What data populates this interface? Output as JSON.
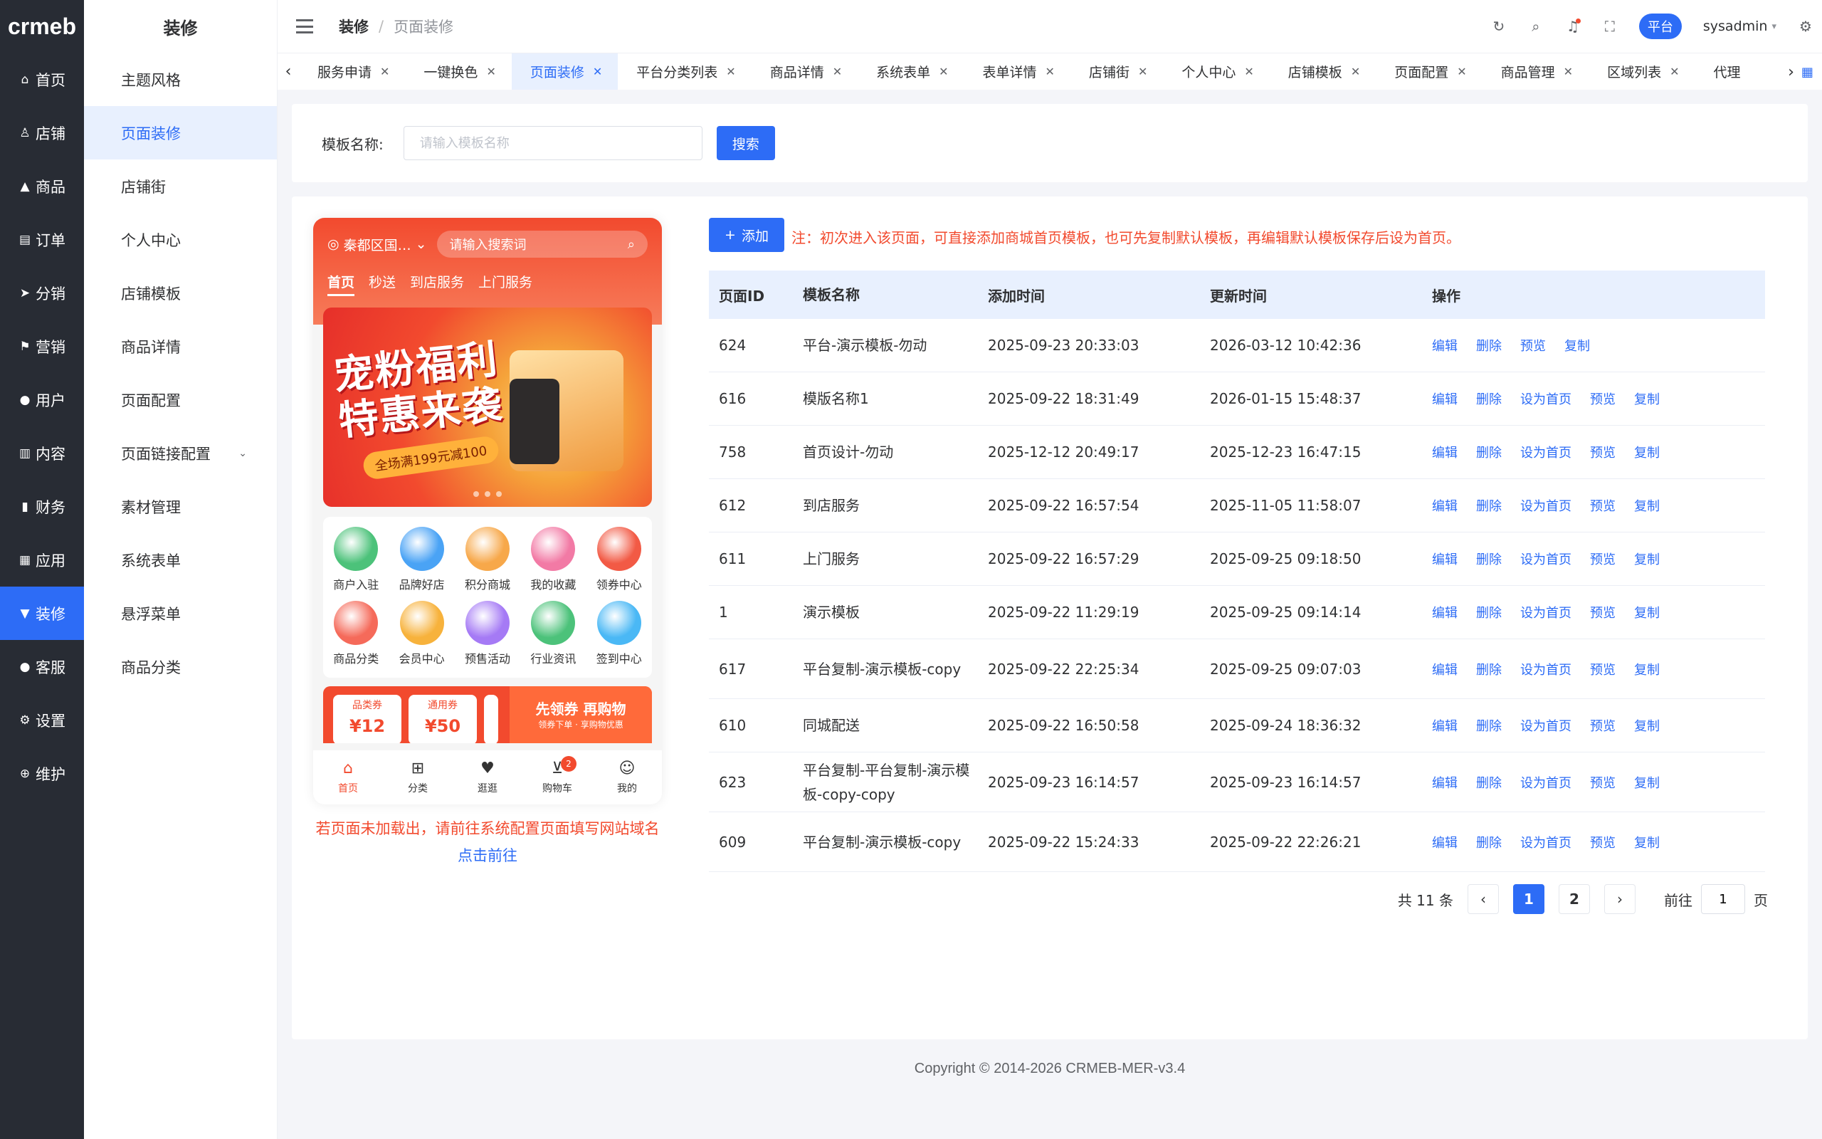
{
  "logo": "crmeb",
  "main_nav": [
    {
      "label": "首页",
      "icon": "home-icon",
      "glyph": "⌂",
      "active": false
    },
    {
      "label": "店铺",
      "icon": "store-icon",
      "glyph": "♙",
      "active": false
    },
    {
      "label": "商品",
      "icon": "bag-icon",
      "glyph": "▲",
      "active": false
    },
    {
      "label": "订单",
      "icon": "order-icon",
      "glyph": "▤",
      "active": false
    },
    {
      "label": "分销",
      "icon": "send-icon",
      "glyph": "➤",
      "active": false
    },
    {
      "label": "营销",
      "icon": "flag-icon",
      "glyph": "⚑",
      "active": false
    },
    {
      "label": "用户",
      "icon": "user-icon",
      "glyph": "●",
      "active": false
    },
    {
      "label": "内容",
      "icon": "content-icon",
      "glyph": "▥",
      "active": false
    },
    {
      "label": "财务",
      "icon": "finance-icon",
      "glyph": "▮",
      "active": false
    },
    {
      "label": "应用",
      "icon": "apps-icon",
      "glyph": "▦",
      "active": false
    },
    {
      "label": "装修",
      "icon": "brush-icon",
      "glyph": "▼",
      "active": true
    },
    {
      "label": "客服",
      "icon": "service-icon",
      "glyph": "●",
      "active": false
    },
    {
      "label": "设置",
      "icon": "gear-icon",
      "glyph": "⚙",
      "active": false
    },
    {
      "label": "维护",
      "icon": "maintain-icon",
      "glyph": "⊕",
      "active": false
    }
  ],
  "sub_nav": {
    "title": "装修",
    "items": [
      {
        "label": "主题风格",
        "active": false
      },
      {
        "label": "页面装修",
        "active": true
      },
      {
        "label": "店铺街",
        "active": false
      },
      {
        "label": "个人中心",
        "active": false
      },
      {
        "label": "店铺模板",
        "active": false
      },
      {
        "label": "商品详情",
        "active": false
      },
      {
        "label": "页面配置",
        "active": false
      },
      {
        "label": "页面链接配置",
        "active": false,
        "expandable": true
      },
      {
        "label": "素材管理",
        "active": false
      },
      {
        "label": "系统表单",
        "active": false
      },
      {
        "label": "悬浮菜单",
        "active": false
      },
      {
        "label": "商品分类",
        "active": false
      }
    ]
  },
  "header": {
    "breadcrumb_1": "装修",
    "breadcrumb_sep": "/",
    "breadcrumb_2": "页面装修",
    "platform_badge": "平台",
    "username": "sysadmin"
  },
  "tabs": [
    {
      "label": "服务申请",
      "active": false
    },
    {
      "label": "一键换色",
      "active": false
    },
    {
      "label": "页面装修",
      "active": true
    },
    {
      "label": "平台分类列表",
      "active": false
    },
    {
      "label": "商品详情",
      "active": false
    },
    {
      "label": "系统表单",
      "active": false
    },
    {
      "label": "表单详情",
      "active": false
    },
    {
      "label": "店铺街",
      "active": false
    },
    {
      "label": "个人中心",
      "active": false
    },
    {
      "label": "店铺模板",
      "active": false
    },
    {
      "label": "页面配置",
      "active": false
    },
    {
      "label": "商品管理",
      "active": false
    },
    {
      "label": "区域列表",
      "active": false
    },
    {
      "label": "代理",
      "active": false
    }
  ],
  "search": {
    "label": "模板名称:",
    "placeholder": "请输入模板名称",
    "button": "搜索"
  },
  "phone": {
    "location": "秦都区国…",
    "search_placeholder": "请输入搜索词",
    "nav": [
      "首页",
      "秒送",
      "到店服务",
      "上门服务"
    ],
    "banner_title_1": "宠粉福利",
    "banner_title_2": "特惠来袭",
    "banner_subtitle": "全场满199元减100",
    "icons": [
      {
        "label": "商户入驻",
        "color": "#4cc27a"
      },
      {
        "label": "品牌好店",
        "color": "#4aa3f5"
      },
      {
        "label": "积分商城",
        "color": "#f7a84a"
      },
      {
        "label": "我的收藏",
        "color": "#f27aa5"
      },
      {
        "label": "领券中心",
        "color": "#f25a45"
      },
      {
        "label": "商品分类",
        "color": "#f56a5a"
      },
      {
        "label": "会员中心",
        "color": "#f7b23c"
      },
      {
        "label": "预售活动",
        "color": "#a57af5"
      },
      {
        "label": "行业资讯",
        "color": "#4cc27a"
      },
      {
        "label": "签到中心",
        "color": "#4ab8f5"
      }
    ],
    "coupons": [
      {
        "tag": "品类券",
        "value": "¥12"
      },
      {
        "tag": "通用券",
        "value": "¥50"
      }
    ],
    "promo_title": "先领券 再购物",
    "promo_sub": "领券下单 · 享购物优惠",
    "tabbar": [
      {
        "label": "首页",
        "icon": "home-icon",
        "glyph": "⌂",
        "on": true
      },
      {
        "label": "分类",
        "icon": "category-icon",
        "glyph": "⊞",
        "on": false
      },
      {
        "label": "逛逛",
        "icon": "browse-icon",
        "glyph": "♥",
        "on": false
      },
      {
        "label": "购物车",
        "icon": "cart-icon",
        "glyph": "⊻",
        "on": false
      },
      {
        "label": "我的",
        "icon": "profile-icon",
        "glyph": "☺",
        "on": false
      }
    ],
    "cart_badge": "2"
  },
  "preview_warning": "若页面未加载出，请前往系统配置页面填写网站域名",
  "preview_link": "点击前往",
  "add_button": "添加",
  "note": "注：初次进入该页面，可直接添加商城首页模板，也可先复制默认模板，再编辑默认模板保存后设为首页。",
  "table": {
    "columns": [
      "页面ID",
      "模板名称",
      "添加时间",
      "更新时间",
      "操作"
    ],
    "rows": [
      {
        "id": "624",
        "name": "平台-演示模板-勿动",
        "created": "2025-09-23 20:33:03",
        "updated": "2026-03-12 10:42:36",
        "actions": [
          "编辑",
          "删除",
          "预览",
          "复制"
        ]
      },
      {
        "id": "616",
        "name": "模版名称1",
        "created": "2025-09-22 18:31:49",
        "updated": "2026-01-15 15:48:37",
        "actions": [
          "编辑",
          "删除",
          "设为首页",
          "预览",
          "复制"
        ]
      },
      {
        "id": "758",
        "name": "首页设计-勿动",
        "created": "2025-12-12 20:49:17",
        "updated": "2025-12-23 16:47:15",
        "actions": [
          "编辑",
          "删除",
          "设为首页",
          "预览",
          "复制"
        ]
      },
      {
        "id": "612",
        "name": "到店服务",
        "created": "2025-09-22 16:57:54",
        "updated": "2025-11-05 11:58:07",
        "actions": [
          "编辑",
          "删除",
          "设为首页",
          "预览",
          "复制"
        ]
      },
      {
        "id": "611",
        "name": "上门服务",
        "created": "2025-09-22 16:57:29",
        "updated": "2025-09-25 09:18:50",
        "actions": [
          "编辑",
          "删除",
          "设为首页",
          "预览",
          "复制"
        ]
      },
      {
        "id": "1",
        "name": "演示模板",
        "created": "2025-09-22 11:29:19",
        "updated": "2025-09-25 09:14:14",
        "actions": [
          "编辑",
          "删除",
          "设为首页",
          "预览",
          "复制"
        ]
      },
      {
        "id": "617",
        "name": "平台复制-演示模板-copy",
        "created": "2025-09-22 22:25:34",
        "updated": "2025-09-25 09:07:03",
        "actions": [
          "编辑",
          "删除",
          "设为首页",
          "预览",
          "复制"
        ]
      },
      {
        "id": "610",
        "name": "同城配送",
        "created": "2025-09-22 16:50:58",
        "updated": "2025-09-24 18:36:32",
        "actions": [
          "编辑",
          "删除",
          "设为首页",
          "预览",
          "复制"
        ]
      },
      {
        "id": "623",
        "name": "平台复制-平台复制-演示模板-copy-copy",
        "created": "2025-09-23 16:14:57",
        "updated": "2025-09-23 16:14:57",
        "actions": [
          "编辑",
          "删除",
          "设为首页",
          "预览",
          "复制"
        ]
      },
      {
        "id": "609",
        "name": "平台复制-演示模板-copy",
        "created": "2025-09-22 15:24:33",
        "updated": "2025-09-22 22:26:21",
        "actions": [
          "编辑",
          "删除",
          "设为首页",
          "预览",
          "复制"
        ]
      }
    ]
  },
  "pagination": {
    "total": "共 11 条",
    "pages": [
      "1",
      "2"
    ],
    "current": "1",
    "goto_label": "前往",
    "goto_value": "1",
    "page_suffix": "页"
  },
  "footer": "Copyright © 2014-2026 CRMEB-MER-v3.4",
  "colors": {
    "primary": "#2d6cf6",
    "sidebar": "#282c34",
    "danger": "#f24a2e"
  }
}
